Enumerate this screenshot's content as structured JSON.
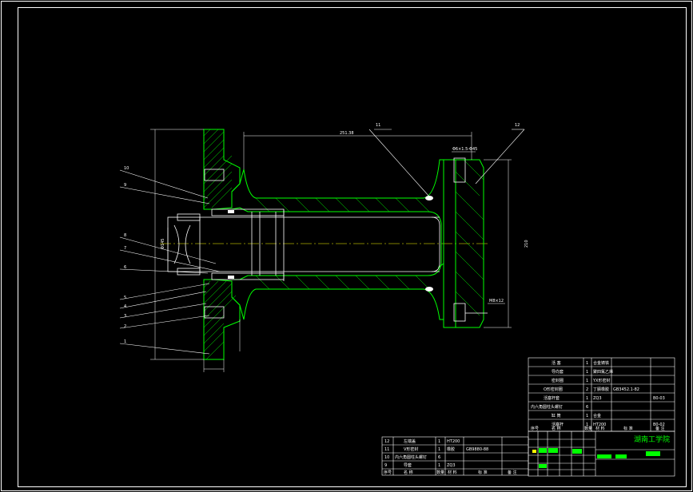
{
  "colors": {
    "background": "#000000",
    "frame": "#ffffff",
    "section": "#00ff00",
    "dimension": "#ffff00",
    "centerline": "#ffff00"
  },
  "drawing": {
    "leaders_left": [
      "10",
      "9",
      "8",
      "7",
      "6",
      "5",
      "4",
      "3",
      "2",
      "1"
    ],
    "leaders_top": [
      "11",
      "12"
    ],
    "dimensions": {
      "top_length": "251.38",
      "right_height": "210",
      "left_bore": "Φ145",
      "right_small": "M8×12",
      "top_right": "Φ6×1.5-Φ45"
    }
  },
  "parts_list": {
    "rows": [
      {
        "no": "12",
        "name": "左端盖",
        "qty": "1",
        "material": "HT200",
        "std": "",
        "note": ""
      },
      {
        "no": "11",
        "name": "V形密封",
        "qty": "1",
        "material": "橡胶",
        "std": "GB9880-88",
        "note": ""
      },
      {
        "no": "10",
        "name": "内六角圆柱头螺钉",
        "qty": "6",
        "material": "",
        "std": "",
        "note": ""
      },
      {
        "no": "9",
        "name": "导套",
        "qty": "1",
        "material": "ZQ3",
        "std": "",
        "note": ""
      }
    ],
    "header": {
      "no": "序号",
      "name": "名 称",
      "qty": "数量",
      "material": "材 料",
      "std": "标 准",
      "note": "备 注"
    }
  },
  "parts_list_upper": {
    "rows": [
      {
        "name": "活 塞",
        "qty": "1",
        "material": "合金铸铁",
        "std": "",
        "note": ""
      },
      {
        "name": "导向套",
        "qty": "1",
        "material": "聚四氟乙烯",
        "std": "",
        "note": ""
      },
      {
        "name": "密封圈",
        "qty": "1",
        "material": "YX形密封",
        "std": "",
        "note": ""
      },
      {
        "name": "O形密封圈",
        "qty": "2",
        "material": "丁腈橡胶",
        "std": "GB3452.1-82",
        "note": ""
      },
      {
        "name": "活塞杆套",
        "qty": "1",
        "material": "ZQ3",
        "std": "",
        "note": "B0-03"
      },
      {
        "name": "内六角圆柱头螺钉",
        "qty": "6",
        "material": "",
        "std": "",
        "note": ""
      },
      {
        "name": "缸 筒",
        "qty": "1",
        "material": "合金",
        "std": "",
        "note": ""
      },
      {
        "name": "活塞杆",
        "qty": "1",
        "material": "HT200",
        "std": "",
        "note": "B0-02"
      }
    ],
    "header": {
      "no": "序号",
      "name": "名 称",
      "qty": "数量",
      "material": "材 料",
      "std": "标 准",
      "note": "备 注"
    }
  },
  "title_block": {
    "school": "湖南工学院"
  }
}
